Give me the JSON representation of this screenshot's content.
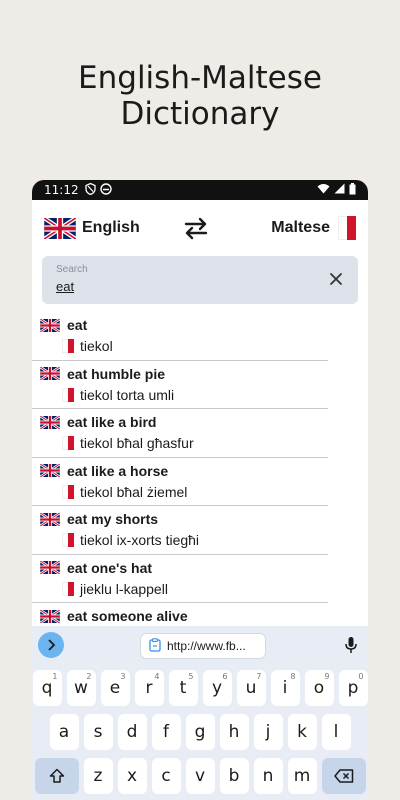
{
  "promo": {
    "line1": "English-Maltese",
    "line2": "Dictionary"
  },
  "status": {
    "time": "11:12"
  },
  "languages": {
    "source": "English",
    "target": "Maltese"
  },
  "search": {
    "label": "Search",
    "value": "eat"
  },
  "results": [
    {
      "term": "eat",
      "translation": "tiekol"
    },
    {
      "term": "eat humble pie",
      "translation": "tiekol torta umli"
    },
    {
      "term": "eat like a bird",
      "translation": "tiekol bħal għasfur"
    },
    {
      "term": "eat like a horse",
      "translation": "tiekol bħal żiemel"
    },
    {
      "term": "eat my shorts",
      "translation": "tiekol ix-xorts tiegħi"
    },
    {
      "term": "eat one's hat",
      "translation": "jieklu l-kappell"
    },
    {
      "term": "eat someone alive",
      "translation": ""
    }
  ],
  "keyboard": {
    "clipboard_text": "http://www.fb...",
    "row1": [
      {
        "k": "q",
        "h": "1"
      },
      {
        "k": "w",
        "h": "2"
      },
      {
        "k": "e",
        "h": "3"
      },
      {
        "k": "r",
        "h": "4"
      },
      {
        "k": "t",
        "h": "5"
      },
      {
        "k": "y",
        "h": "6"
      },
      {
        "k": "u",
        "h": "7"
      },
      {
        "k": "i",
        "h": "8"
      },
      {
        "k": "o",
        "h": "9"
      },
      {
        "k": "p",
        "h": "0"
      }
    ],
    "row2": [
      "a",
      "s",
      "d",
      "f",
      "g",
      "h",
      "j",
      "k",
      "l"
    ],
    "row3": [
      "z",
      "x",
      "c",
      "v",
      "b",
      "n",
      "m"
    ]
  },
  "colors": {
    "malta_red": "#cf142b",
    "search_bg": "#dde2ea",
    "keyboard_bg": "#e8edf5"
  }
}
